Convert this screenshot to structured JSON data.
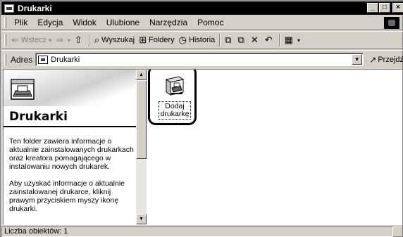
{
  "window": {
    "title": "Drukarki"
  },
  "window_controls": {
    "minimize": "_",
    "maximize": "□",
    "close": "×"
  },
  "menu": [
    "Plik",
    "Edycja",
    "Widok",
    "Ulubione",
    "Narzędzia",
    "Pomoc"
  ],
  "toolbar": {
    "back": "Wstecz",
    "search": "Wyszukaj",
    "folders": "Foldery",
    "history": "Historia"
  },
  "address": {
    "label": "Adres",
    "value": "Drukarki",
    "go": "Przejdź"
  },
  "left_pane": {
    "title": "Drukarki",
    "paragraphs": [
      "Ten folder zawiera informacje o aktualnie zainstalowanych drukarkach oraz kreatora pomagającego w instalowaniu nowych drukarek.",
      "Aby uzyskać informacje o aktualnie zainstalowanej drukarce, kliknij prawym przyciskiem myszy ikonę drukarki."
    ]
  },
  "items": [
    {
      "label_line1": "Dodaj",
      "label_line2": "drukarkę",
      "icon": "add-printer-icon"
    }
  ],
  "status": {
    "text": "Liczba obiektów: 1"
  }
}
